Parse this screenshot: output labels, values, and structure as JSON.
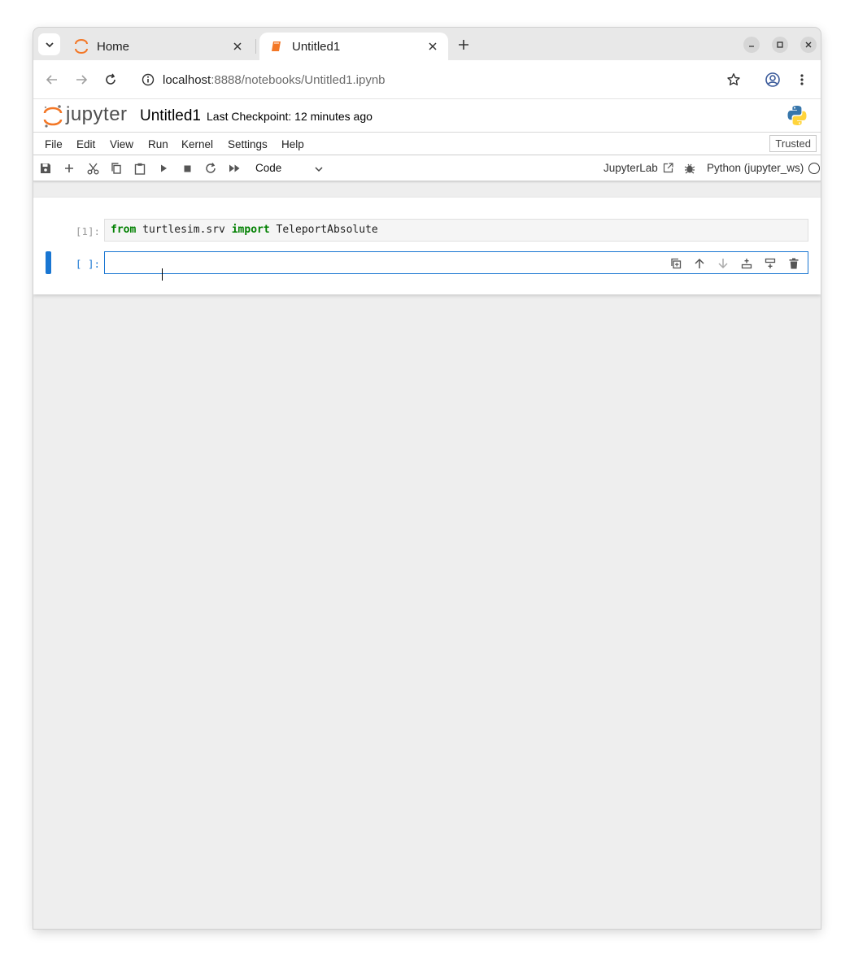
{
  "browser": {
    "tabs": [
      {
        "title": "Home",
        "icon": "jupyter-icon",
        "active": false
      },
      {
        "title": "Untitled1",
        "icon": "notebook-icon",
        "active": true
      }
    ],
    "url_host": "localhost",
    "url_rest": ":8888/notebooks/Untitled1.ipynb"
  },
  "jupyter": {
    "logo_text": "jupyter",
    "notebook_title": "Untitled1",
    "checkpoint": "Last Checkpoint: 12 minutes ago",
    "menu": [
      "File",
      "Edit",
      "View",
      "Run",
      "Kernel",
      "Settings",
      "Help"
    ],
    "trusted": "Trusted",
    "cell_type": "Code",
    "jupyterlab_link": "JupyterLab",
    "kernel_name": "Python (jupyter_ws)"
  },
  "cells": [
    {
      "prompt": "[1]:",
      "code_kw1": "from",
      "code_mid": " turtlesim.srv ",
      "code_kw2": "import",
      "code_end": " TeleportAbsolute"
    },
    {
      "prompt": "[ ]:",
      "code": ""
    }
  ],
  "colors": {
    "accent": "#1976d2",
    "keyword": "#008000",
    "jupyter_orange": "#f37726"
  }
}
